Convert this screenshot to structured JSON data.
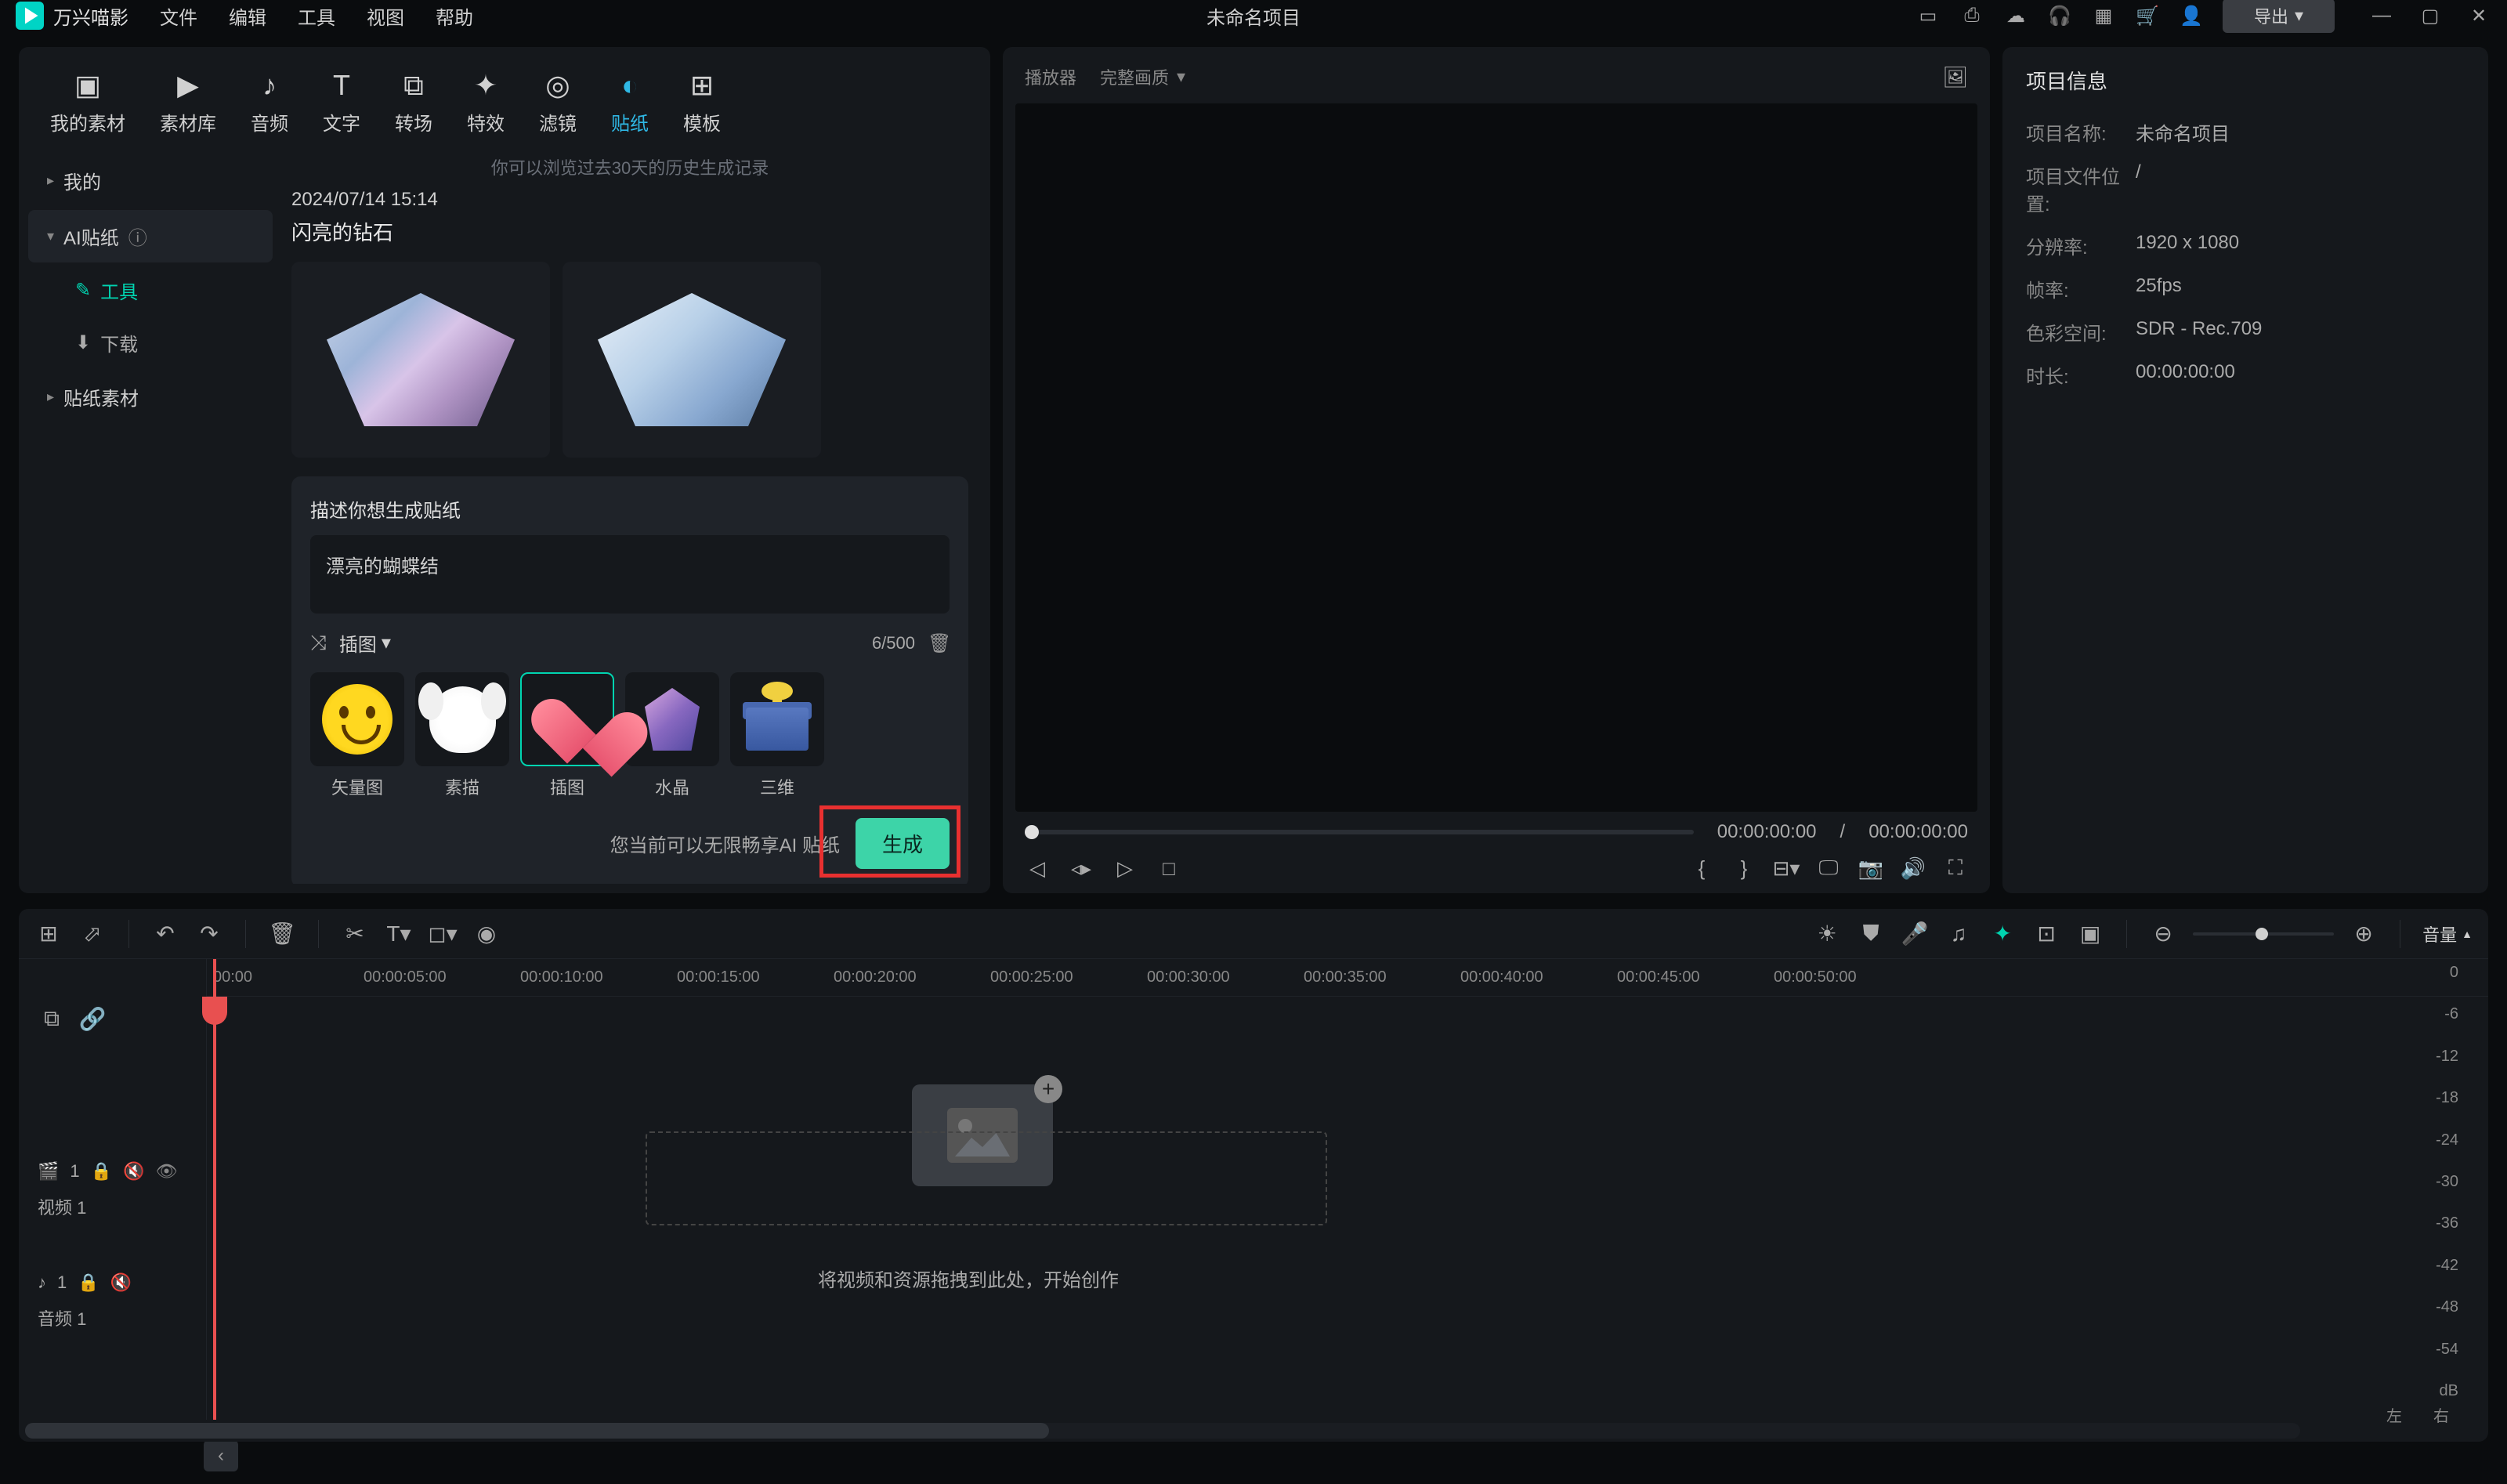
{
  "app": {
    "name": "万兴喵影",
    "project_title": "未命名项目"
  },
  "menu": [
    "文件",
    "编辑",
    "工具",
    "视图",
    "帮助"
  ],
  "export_label": "导出",
  "tabs": [
    {
      "label": "我的素材",
      "icon": "clip"
    },
    {
      "label": "素材库",
      "icon": "play"
    },
    {
      "label": "音频",
      "icon": "music"
    },
    {
      "label": "文字",
      "icon": "text"
    },
    {
      "label": "转场",
      "icon": "transition"
    },
    {
      "label": "特效",
      "icon": "effects"
    },
    {
      "label": "滤镜",
      "icon": "filter"
    },
    {
      "label": "贴纸",
      "icon": "sticker",
      "active": true
    },
    {
      "label": "模板",
      "icon": "template"
    }
  ],
  "sidebar": {
    "items": [
      {
        "label": "我的",
        "type": "group"
      },
      {
        "label": "AI贴纸",
        "type": "group",
        "expanded": true,
        "badge": true
      },
      {
        "label": "工具",
        "type": "sub",
        "active": true,
        "icon": "wand"
      },
      {
        "label": "下载",
        "type": "sub",
        "icon": "download"
      },
      {
        "label": "贴纸素材",
        "type": "group"
      }
    ]
  },
  "content": {
    "history_hint": "你可以浏览过去30天的历史生成记录",
    "timestamp": "2024/07/14 15:14",
    "section_title": "闪亮的钻石"
  },
  "prompt": {
    "title": "描述你想生成贴纸",
    "value": "漂亮的蝴蝶结",
    "style_dropdown": "插图",
    "counter": "6/500",
    "styles": [
      {
        "label": "矢量图",
        "icon": "smiley"
      },
      {
        "label": "素描",
        "icon": "dog"
      },
      {
        "label": "插图",
        "icon": "heart",
        "selected": true
      },
      {
        "label": "水晶",
        "icon": "crystal"
      },
      {
        "label": "三维",
        "icon": "gift"
      }
    ],
    "gen_hint": "您当前可以无限畅享AI 贴纸",
    "gen_button": "生成"
  },
  "preview": {
    "title": "播放器",
    "quality": "完整画质",
    "current_time": "00:00:00:00",
    "total_time": "00:00:00:00"
  },
  "info": {
    "title": "项目信息",
    "rows": [
      {
        "label": "项目名称:",
        "value": "未命名项目"
      },
      {
        "label": "项目文件位置:",
        "value": "/"
      },
      {
        "label": "分辨率:",
        "value": "1920 x 1080"
      },
      {
        "label": "帧率:",
        "value": "25fps"
      },
      {
        "label": "色彩空间:",
        "value": "SDR - Rec.709"
      },
      {
        "label": "时长:",
        "value": "00:00:00:00"
      }
    ]
  },
  "timeline": {
    "volume_label": "音量",
    "ruler": [
      "00:00",
      "00:00:05:00",
      "00:00:10:00",
      "00:00:15:00",
      "00:00:20:00",
      "00:00:25:00",
      "00:00:30:00",
      "00:00:35:00",
      "00:00:40:00",
      "00:00:45:00",
      "00:00:50:00"
    ],
    "tracks": [
      {
        "icon": "video",
        "name": "视频 1",
        "num": "1"
      },
      {
        "icon": "audio",
        "name": "音频 1",
        "num": "1"
      }
    ],
    "drop_text": "将视频和资源拖拽到此处，开始创作",
    "meter": [
      "0",
      "-6",
      "-12",
      "-18",
      "-24",
      "-30",
      "-36",
      "-42",
      "-48",
      "-54",
      "dB"
    ],
    "meter_lr": [
      "左",
      "右"
    ]
  }
}
